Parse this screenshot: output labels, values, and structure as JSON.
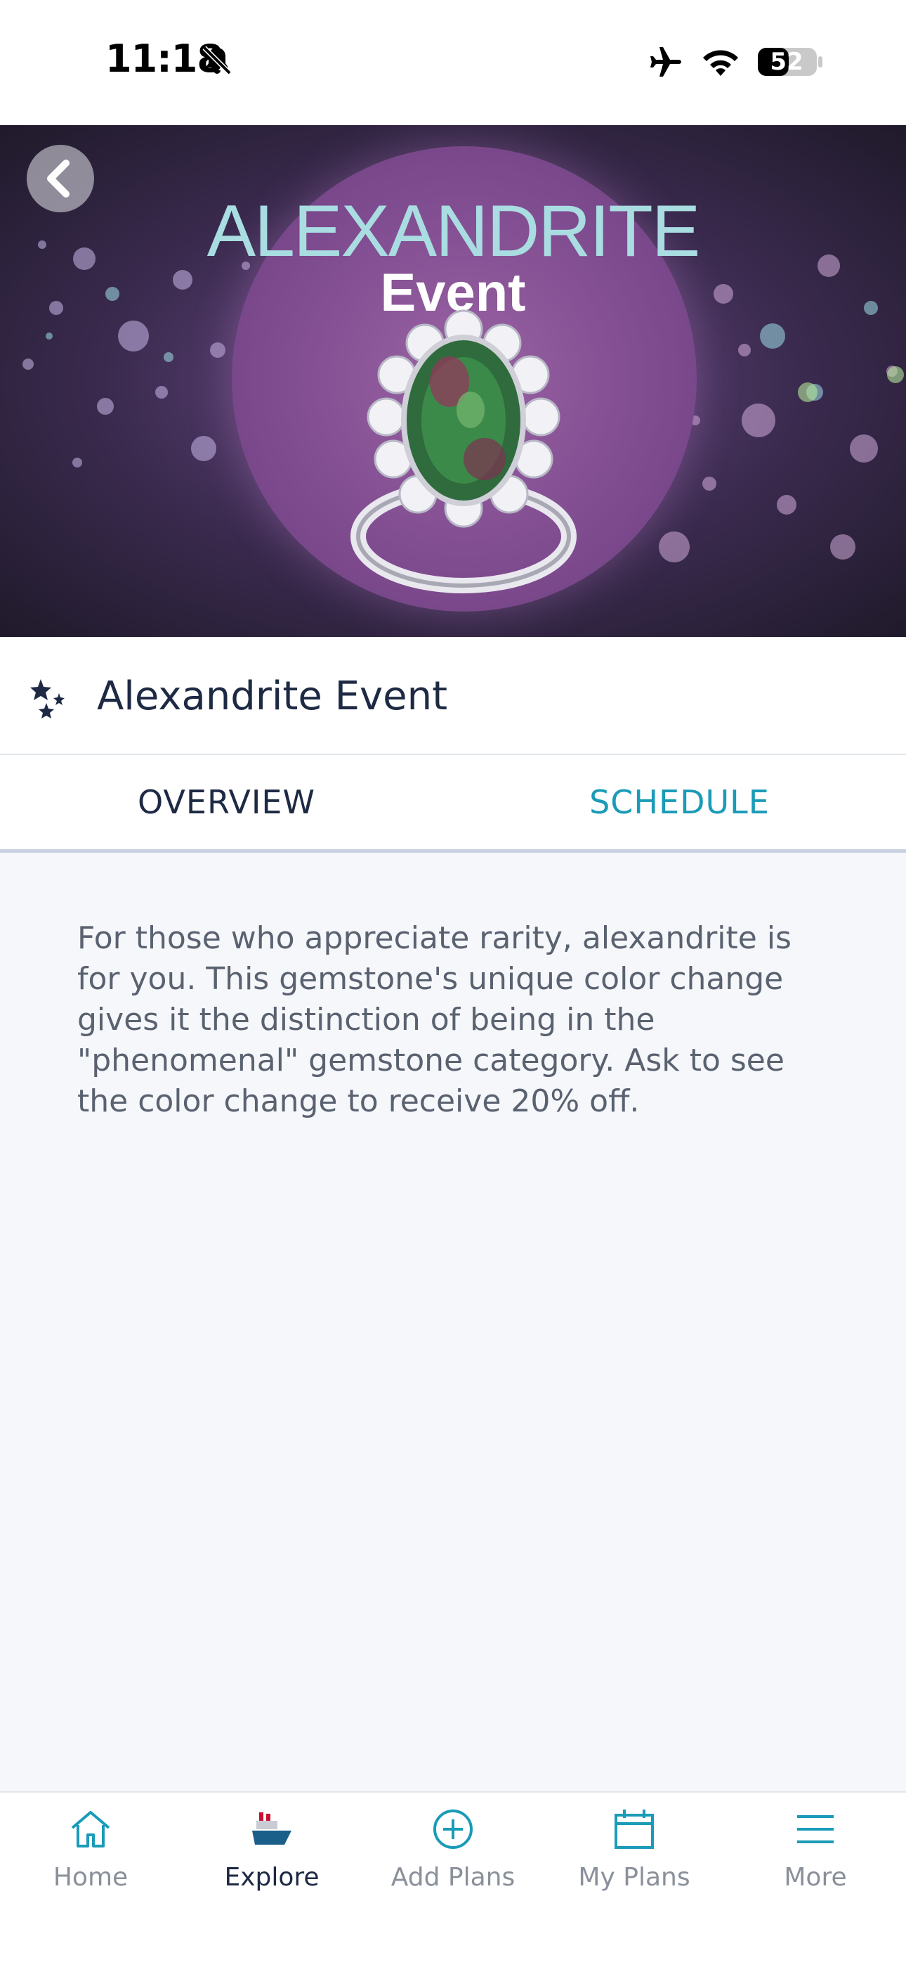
{
  "status_bar": {
    "time": "11:18",
    "battery_level": "52"
  },
  "hero": {
    "title": "ALEXANDRITE",
    "subtitle": "Event"
  },
  "event": {
    "title": "Alexandrite Event"
  },
  "tabs": [
    {
      "label": "OVERVIEW",
      "selected": true
    },
    {
      "label": "SCHEDULE",
      "selected": false
    }
  ],
  "overview": {
    "description": "For those who appreciate rarity, alexandrite is for you. This gemstone's unique color change gives it the distinction of being in the \"phenomenal\" gemstone category. Ask to see the color change to receive 20% off."
  },
  "bottom_nav": [
    {
      "label": "Home",
      "icon": "home-icon",
      "active": false
    },
    {
      "label": "Explore",
      "icon": "ship-icon",
      "active": true
    },
    {
      "label": "Add Plans",
      "icon": "add-circle-icon",
      "active": false
    },
    {
      "label": "My Plans",
      "icon": "calendar-icon",
      "active": false
    },
    {
      "label": "More",
      "icon": "menu-icon",
      "active": false
    }
  ],
  "colors": {
    "accent": "#1a9bb8",
    "text_dark": "#1e2a44",
    "background": "#f5f7fb"
  }
}
